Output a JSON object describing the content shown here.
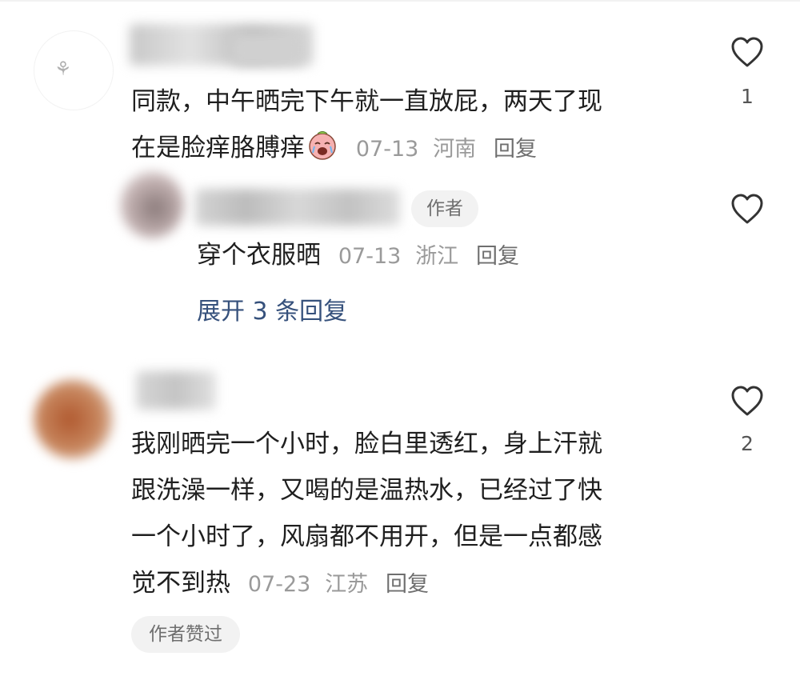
{
  "comments": [
    {
      "text_line1": "同款，中午晒完下午就一直放屁，两天了现",
      "text_line2": "在是脸痒胳膊痒",
      "date": "07-13",
      "location": "河南",
      "reply_label": "回复",
      "like_count": "1",
      "emoji": "crying-face-sticker",
      "replies": [
        {
          "badge": "作者",
          "text": "穿个衣服晒",
          "date": "07-13",
          "location": "浙江",
          "reply_label": "回复"
        }
      ],
      "expand_label": "展开 3 条回复"
    },
    {
      "text_line1": "我刚晒完一个小时，脸白里透红，身上汗就",
      "text_line2": "跟洗澡一样，又喝的是温热水，已经过了快",
      "text_line3": "一个小时了，风扇都不用开，但是一点都感",
      "text_line4": "觉不到热",
      "date": "07-23",
      "location": "江苏",
      "reply_label": "回复",
      "like_count": "2",
      "author_liked_label": "作者赞过"
    }
  ],
  "icons": {
    "like": "heart-outline-icon"
  },
  "colors": {
    "link": "#36517c",
    "meta": "#9a9a9a",
    "badge_bg": "#f2f2f2"
  }
}
